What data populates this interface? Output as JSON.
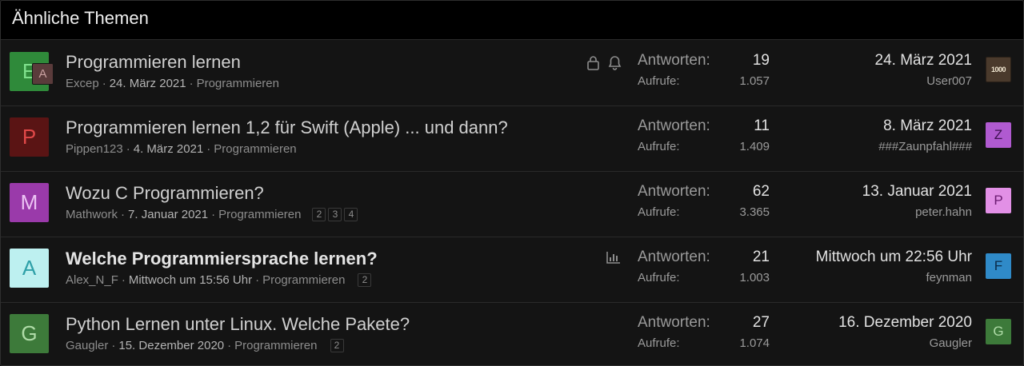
{
  "header": {
    "title": "Ähnliche Themen"
  },
  "threads": [
    {
      "avatar_letter": "E",
      "avatar_bg": "#2f8a3a",
      "avatar_fg": "#7fe08c",
      "sub_avatar_letter": "A",
      "title": "Programmieren lernen",
      "author": "Excep",
      "date": "24. März 2021",
      "forum": "Programmieren",
      "pages": [],
      "icons": [
        "lock-icon",
        "bell-icon"
      ],
      "replies_label": "Antworten:",
      "replies": "19",
      "views_label": "Aufrufe:",
      "views": "1.057",
      "last_date": "24. März 2021",
      "last_user": "User007",
      "last_avatar_letter": "1000",
      "last_avatar_bg": "#5a4a3a",
      "last_avatar_fg": "#e8dcc8"
    },
    {
      "avatar_letter": "P",
      "avatar_bg": "#5a1414",
      "avatar_fg": "#e04848",
      "title": "Programmieren lernen 1,2 für Swift (Apple) ... und dann?",
      "author": "Pippen123",
      "date": "4. März 2021",
      "forum": "Programmieren",
      "pages": [],
      "icons": [],
      "replies_label": "Antworten:",
      "replies": "11",
      "views_label": "Aufrufe:",
      "views": "1.409",
      "last_date": "8. März 2021",
      "last_user": "###Zaunpfahl###",
      "last_avatar_letter": "Z",
      "last_avatar_bg": "#b05ad0",
      "last_avatar_fg": "#3d1050"
    },
    {
      "avatar_letter": "M",
      "avatar_bg": "#9a3aaa",
      "avatar_fg": "#ecc4f4",
      "title": "Wozu C Programmieren?",
      "author": "Mathwork",
      "date": "7. Januar 2021",
      "forum": "Programmieren",
      "pages": [
        "2",
        "3",
        "4"
      ],
      "icons": [],
      "replies_label": "Antworten:",
      "replies": "62",
      "views_label": "Aufrufe:",
      "views": "3.365",
      "last_date": "13. Januar 2021",
      "last_user": "peter.hahn",
      "last_avatar_letter": "P",
      "last_avatar_bg": "#e290e6",
      "last_avatar_fg": "#6a1a70"
    },
    {
      "avatar_letter": "A",
      "avatar_bg": "#bdf0f0",
      "avatar_fg": "#2fa0a8",
      "title": "Welche Programmiersprache lernen?",
      "author": "Alex_N_F",
      "date": "Mittwoch um 15:56 Uhr",
      "forum": "Programmieren",
      "pages": [
        "2"
      ],
      "icons": [
        "poll-icon"
      ],
      "replies_label": "Antworten:",
      "replies": "21",
      "views_label": "Aufrufe:",
      "views": "1.003",
      "last_date": "Mittwoch um 22:56 Uhr",
      "last_user": "feynman",
      "last_avatar_letter": "F",
      "last_avatar_bg": "#2f8ac8",
      "last_avatar_fg": "#0a2a48"
    },
    {
      "avatar_letter": "G",
      "avatar_bg": "#3d7a3a",
      "avatar_fg": "#b0dca8",
      "title": "Python Lernen unter Linux. Welche Pakete?",
      "author": "Gaugler",
      "date": "15. Dezember 2020",
      "forum": "Programmieren",
      "pages": [
        "2"
      ],
      "icons": [],
      "replies_label": "Antworten:",
      "replies": "27",
      "views_label": "Aufrufe:",
      "views": "1.074",
      "last_date": "16. Dezember 2020",
      "last_user": "Gaugler",
      "last_avatar_letter": "G",
      "last_avatar_bg": "#3d7a3a",
      "last_avatar_fg": "#b0dca8"
    }
  ]
}
